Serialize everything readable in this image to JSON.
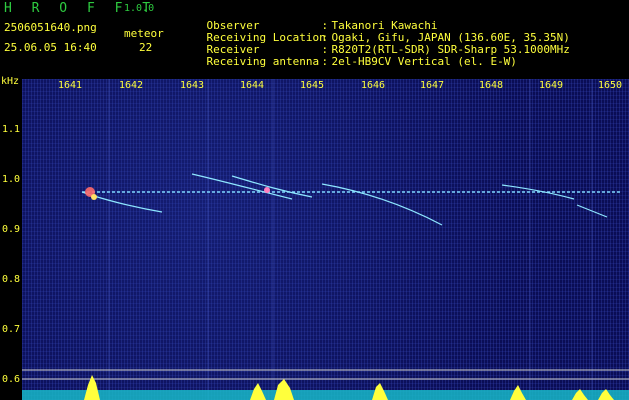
{
  "app": {
    "title": "H R O F F T",
    "version": "1.0.0"
  },
  "meta": {
    "filename": "2506051640.png",
    "datetime": "25.06.05 16:40",
    "meteor_label": "meteor",
    "meteor_count": "22"
  },
  "info": [
    {
      "key": "Observer",
      "value": "Takanori Kawachi"
    },
    {
      "key": "Receiving Location",
      "value": "Ogaki, Gifu, JAPAN (136.60E, 35.35N)"
    },
    {
      "key": "Receiver",
      "value": "R820T2(RTL-SDR) SDR-Sharp 53.1000MHz"
    },
    {
      "key": "Receiving antenna",
      "value": "2el-HB9CV Vertical (el. E-W)"
    }
  ],
  "axis": {
    "unit": "kHz",
    "time_ticks": [
      "1641",
      "1642",
      "1643",
      "1644",
      "1645",
      "1646",
      "1647",
      "1648",
      "1649",
      "1650"
    ],
    "freq_ticks": [
      "1.1",
      "1.0",
      "0.9",
      "0.8",
      "0.7",
      "0.6"
    ]
  },
  "colors": {
    "label": "#ffff3c",
    "title": "#2ecc40",
    "background": "#0a0d55",
    "signal_line": "#7fd8ff"
  }
}
